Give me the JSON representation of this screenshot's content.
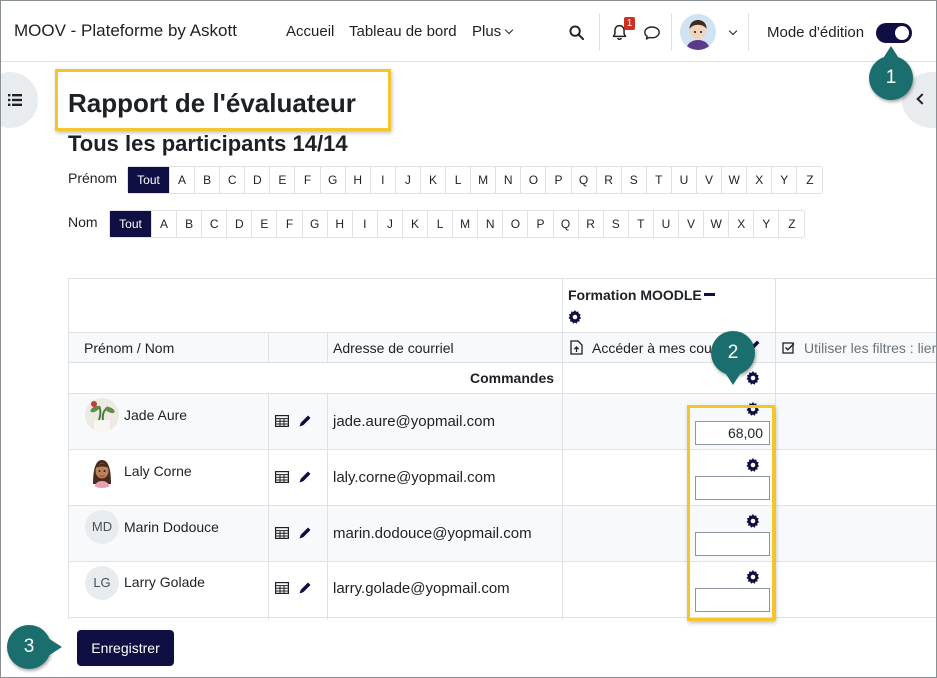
{
  "navbar": {
    "brand": "MOOV - Plateforme by Askott",
    "links": [
      "Accueil",
      "Tableau de bord",
      "Plus"
    ],
    "notification_count": "1",
    "edit_mode_label": "Mode d'édition",
    "edit_mode_on": true
  },
  "callouts": [
    "1",
    "2",
    "3"
  ],
  "page": {
    "title": "Rapport de l'évaluateur",
    "subtitle": "Tous les participants 14/14"
  },
  "filters": {
    "firstname_label": "Prénom",
    "lastname_label": "Nom",
    "all_label": "Tout",
    "letters": [
      "A",
      "B",
      "C",
      "D",
      "E",
      "F",
      "G",
      "H",
      "I",
      "J",
      "K",
      "L",
      "M",
      "N",
      "O",
      "P",
      "Q",
      "R",
      "S",
      "T",
      "U",
      "V",
      "W",
      "X",
      "Y",
      "Z"
    ]
  },
  "table": {
    "course_name": "Formation MOODLE",
    "col_name": "Prénom / Nom",
    "col_email": "Adresse de courriel",
    "col_item1": "Accéder à mes cour",
    "col_item2": "Utiliser les filtres : lier",
    "controls_label": "Commandes",
    "rows": [
      {
        "initials": "",
        "name": "Jade Aure",
        "email": "jade.aure@yopmail.com",
        "grade": "68,00"
      },
      {
        "initials": "",
        "name": "Laly Corne",
        "email": "laly.corne@yopmail.com",
        "grade": ""
      },
      {
        "initials": "MD",
        "name": "Marin Dodouce",
        "email": "marin.dodouce@yopmail.com",
        "grade": ""
      },
      {
        "initials": "LG",
        "name": "Larry Golade",
        "email": "larry.golade@yopmail.com",
        "grade": ""
      }
    ]
  },
  "save_label": "Enregistrer",
  "colors": {
    "accent": "#0f0f43",
    "highlight": "#f5c62b",
    "callout": "#1b6e6e"
  }
}
